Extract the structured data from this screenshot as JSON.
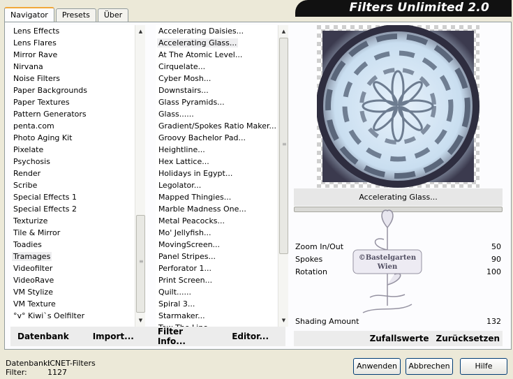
{
  "banner": {
    "title": "Filters Unlimited 2.0"
  },
  "tabs": [
    {
      "label": "Navigator",
      "active": true
    },
    {
      "label": "Presets",
      "active": false
    },
    {
      "label": "Über",
      "active": false
    }
  ],
  "categories": {
    "items": [
      "Lens Effects",
      "Lens Flares",
      "Mirror Rave",
      "Nirvana",
      "Noise Filters",
      "Paper Backgrounds",
      "Paper Textures",
      "Pattern Generators",
      "penta.com",
      "Photo Aging Kit",
      "Pixelate",
      "Psychosis",
      "Render",
      "Scribe",
      "Special Effects 1",
      "Special Effects 2",
      "Texturize",
      "Tile & Mirror",
      "Toadies",
      "Tramages",
      "Videofilter",
      "VideoRave",
      "VM Stylize",
      "VM Texture",
      "°v° Kiwi`s Oelfilter"
    ],
    "selected": "Tramages"
  },
  "filters": {
    "items": [
      "Accelerating Daisies...",
      "Accelerating Glass...",
      "At The Atomic Level...",
      "Cirquelate...",
      "Cyber Mosh...",
      "Downstairs...",
      "Glass Pyramids...",
      "Glass......",
      "Gradient/Spokes Ratio Maker...",
      "Groovy Bachelor Pad...",
      "Heightline...",
      "Hex Lattice...",
      "Holidays in Egypt...",
      "Legolator...",
      "Mapped Thingies...",
      "Marble Madness One...",
      "Metal Peacocks...",
      "Mo' Jellyfish...",
      "MovingScreen...",
      "Panel Stripes...",
      "Perforator 1...",
      "Print Screen...",
      "Quilt......",
      "Spiral 3...",
      "Starmaker...",
      "Tow The Line..."
    ],
    "selected": "Accelerating Glass..."
  },
  "bottom_links": {
    "datenbank": "Datenbank",
    "import": "Import...",
    "filter_info": "Filter Info...",
    "editor": "Editor..."
  },
  "preview": {
    "filter_name": "Accelerating Glass..."
  },
  "params": [
    {
      "label": "Zoom In/Out",
      "value": "50"
    },
    {
      "label": "Spokes",
      "value": "90"
    },
    {
      "label": "Rotation",
      "value": "100"
    }
  ],
  "shading": {
    "label": "Shading Amount",
    "value": "132"
  },
  "right_links": {
    "random": "Zufallswerte",
    "reset": "Zurücksetzen"
  },
  "status": {
    "db_label": "Datenbank:",
    "db_value": "ICNET-Filters",
    "filter_label": "Filter:",
    "filter_value": "1127"
  },
  "watermark": {
    "line1": "©Bastelgarten",
    "line2": "Wien"
  },
  "buttons": {
    "apply": "Anwenden",
    "cancel": "Abbrechen",
    "help": "Hilfe"
  }
}
